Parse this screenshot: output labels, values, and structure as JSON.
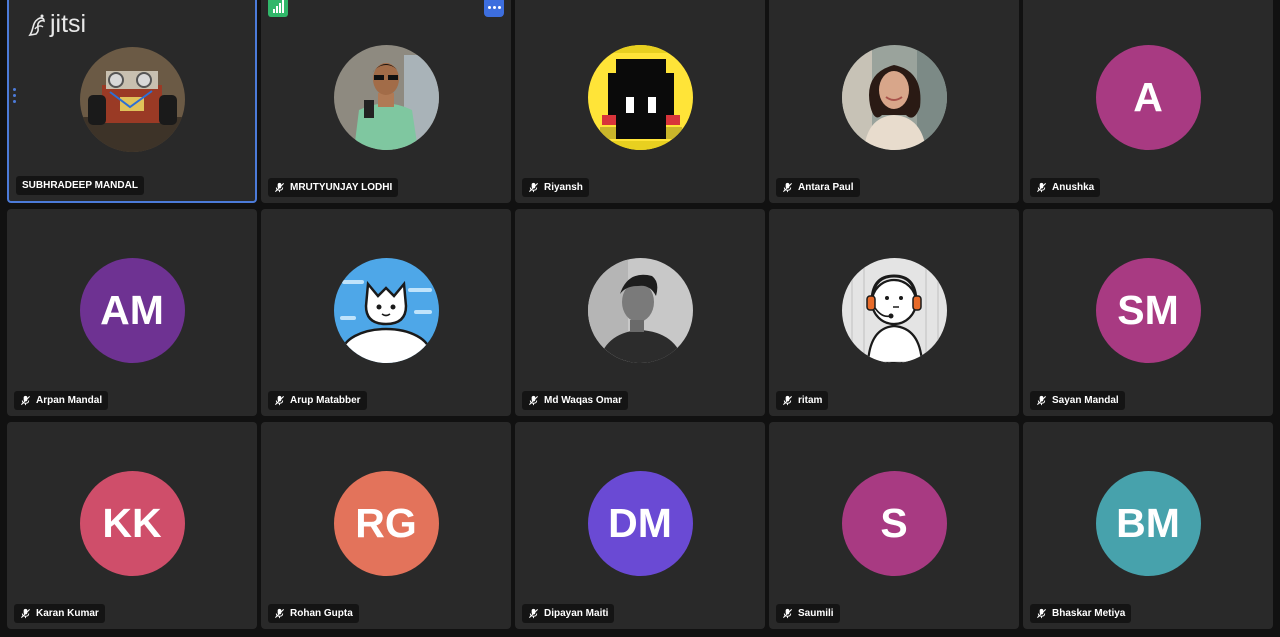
{
  "app": {
    "logo_text": "jitsi"
  },
  "colors": {
    "tile_bg": "#292929",
    "active_border": "#4c7bd9",
    "badge_bg": "#141414",
    "signal_green": "#31b76a",
    "menu_blue": "#3d6ede"
  },
  "participants": [
    {
      "name": "SUBHRADEEP MANDAL",
      "avatar": "photo-robot-car",
      "muted": false,
      "active": true
    },
    {
      "name": "MRUTYUNJAY LODHI",
      "avatar": "photo-man-selfie",
      "muted": true
    },
    {
      "name": "Riyansh",
      "avatar": "pixel-art-yellow-face",
      "muted": true
    },
    {
      "name": "Antara Paul",
      "avatar": "photo-woman-smiling",
      "muted": true
    },
    {
      "name": "Anushka",
      "initials": "A",
      "color": "#a83a82",
      "muted": true
    },
    {
      "name": "Arpan Mandal",
      "initials": "AM",
      "color": "#6e3292",
      "muted": true
    },
    {
      "name": "Arup Matabber",
      "avatar": "cartoon-cat-cloud",
      "muted": true
    },
    {
      "name": "Md Waqas Omar",
      "avatar": "photo-man-grayscale",
      "muted": true
    },
    {
      "name": "ritam",
      "avatar": "cartoon-headset-character",
      "muted": true
    },
    {
      "name": "Sayan Mandal",
      "initials": "SM",
      "color": "#a83a82",
      "muted": true
    },
    {
      "name": "Karan Kumar",
      "initials": "KK",
      "color": "#cf4e6a",
      "muted": true
    },
    {
      "name": "Rohan Gupta",
      "initials": "RG",
      "color": "#e3735b",
      "muted": true
    },
    {
      "name": "Dipayan Maiti",
      "initials": "DM",
      "color": "#6a4ad4",
      "muted": true
    },
    {
      "name": "Saumili",
      "initials": "S",
      "color": "#a83a82",
      "muted": true
    },
    {
      "name": "Bhaskar Metiya",
      "initials": "BM",
      "color": "#47a2ac",
      "muted": true
    }
  ]
}
